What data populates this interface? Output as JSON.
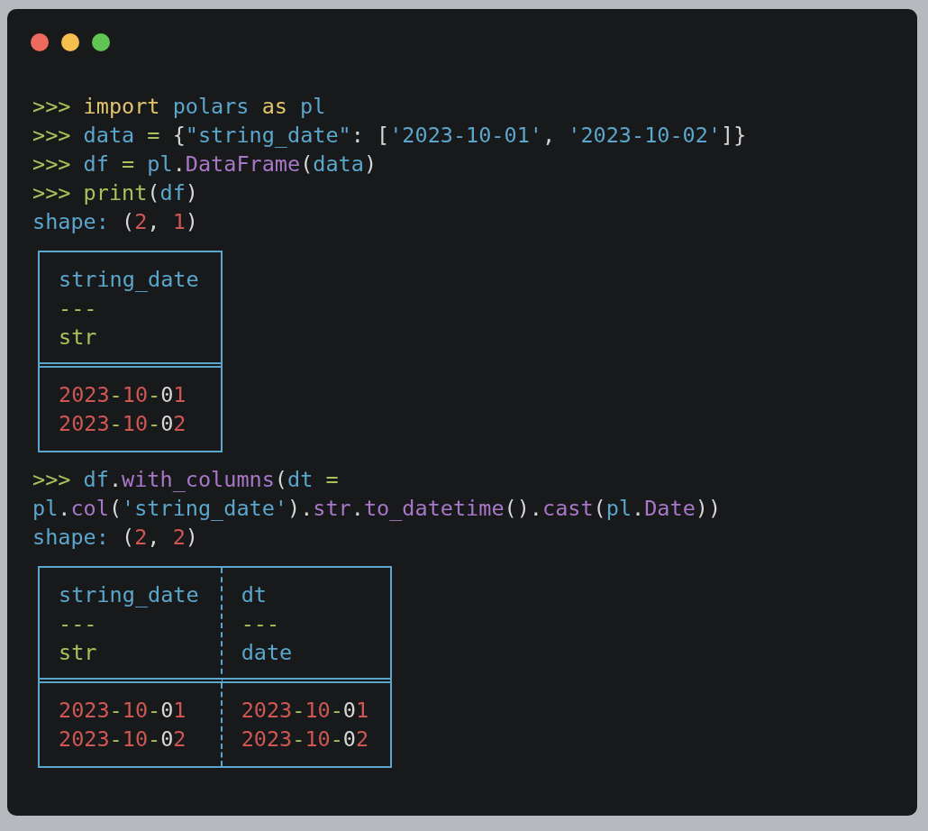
{
  "window_controls": [
    {
      "color": "#ec6a5e"
    },
    {
      "color": "#f4bf4f"
    },
    {
      "color": "#61c554"
    }
  ],
  "blocks": [
    {
      "kind": "line",
      "tokens": [
        {
          "text": ">>> ",
          "kind": "prompt"
        },
        {
          "text": "import",
          "kind": "keyword"
        },
        {
          "text": " polars ",
          "kind": "ident"
        },
        {
          "text": "as",
          "kind": "keyword"
        },
        {
          "text": " pl",
          "kind": "ident"
        }
      ]
    },
    {
      "kind": "line",
      "tokens": [
        {
          "text": ">>> ",
          "kind": "prompt"
        },
        {
          "text": "data ",
          "kind": "ident"
        },
        {
          "text": "=",
          "kind": "op"
        },
        {
          "text": " {",
          "kind": "punct"
        },
        {
          "text": "\"string_date\"",
          "kind": "ident"
        },
        {
          "text": ": [",
          "kind": "punct"
        },
        {
          "text": "'2023-10-01'",
          "kind": "ident"
        },
        {
          "text": ", ",
          "kind": "punct"
        },
        {
          "text": "'2023-10-02'",
          "kind": "ident"
        },
        {
          "text": "]}",
          "kind": "punct"
        }
      ]
    },
    {
      "kind": "line",
      "tokens": [
        {
          "text": ">>> ",
          "kind": "prompt"
        },
        {
          "text": "df ",
          "kind": "ident"
        },
        {
          "text": "=",
          "kind": "op"
        },
        {
          "text": " pl",
          "kind": "ident"
        },
        {
          "text": ".",
          "kind": "punct"
        },
        {
          "text": "DataFrame",
          "kind": "func"
        },
        {
          "text": "(",
          "kind": "punct"
        },
        {
          "text": "data",
          "kind": "ident"
        },
        {
          "text": ")",
          "kind": "punct"
        }
      ]
    },
    {
      "kind": "line",
      "tokens": [
        {
          "text": ">>> ",
          "kind": "prompt"
        },
        {
          "text": "print",
          "kind": "op"
        },
        {
          "text": "(",
          "kind": "punct"
        },
        {
          "text": "df",
          "kind": "ident"
        },
        {
          "text": ")",
          "kind": "punct"
        }
      ]
    },
    {
      "kind": "line",
      "tokens": [
        {
          "text": "shape: ",
          "kind": "ident"
        },
        {
          "text": "(",
          "kind": "punct"
        },
        {
          "text": "2",
          "kind": "number"
        },
        {
          "text": ", ",
          "kind": "punct"
        },
        {
          "text": "1",
          "kind": "number"
        },
        {
          "text": ")",
          "kind": "punct"
        }
      ]
    },
    {
      "kind": "table",
      "columns": [
        {
          "name": [
            {
              "text": "string_date",
              "kind": "ident"
            }
          ],
          "separator": [
            {
              "text": "---",
              "kind": "op"
            }
          ],
          "dtype": [
            {
              "text": "str",
              "kind": "op"
            }
          ]
        }
      ],
      "rows": [
        [
          [
            {
              "text": "2023",
              "kind": "number"
            },
            {
              "text": "-",
              "kind": "op"
            },
            {
              "text": "10",
              "kind": "number"
            },
            {
              "text": "-",
              "kind": "op"
            },
            {
              "text": "0",
              "kind": "punct"
            },
            {
              "text": "1",
              "kind": "number"
            }
          ]
        ],
        [
          [
            {
              "text": "2023",
              "kind": "number"
            },
            {
              "text": "-",
              "kind": "op"
            },
            {
              "text": "10",
              "kind": "number"
            },
            {
              "text": "-",
              "kind": "op"
            },
            {
              "text": "0",
              "kind": "punct"
            },
            {
              "text": "2",
              "kind": "number"
            }
          ]
        ]
      ]
    },
    {
      "kind": "line",
      "tokens": [
        {
          "text": ">>> ",
          "kind": "prompt"
        },
        {
          "text": "df",
          "kind": "ident"
        },
        {
          "text": ".",
          "kind": "punct"
        },
        {
          "text": "with_columns",
          "kind": "func"
        },
        {
          "text": "(",
          "kind": "punct"
        },
        {
          "text": "dt ",
          "kind": "ident"
        },
        {
          "text": "=",
          "kind": "op"
        }
      ]
    },
    {
      "kind": "line",
      "tokens": [
        {
          "text": "pl",
          "kind": "ident"
        },
        {
          "text": ".",
          "kind": "punct"
        },
        {
          "text": "col",
          "kind": "func"
        },
        {
          "text": "(",
          "kind": "punct"
        },
        {
          "text": "'string_date'",
          "kind": "ident"
        },
        {
          "text": ").",
          "kind": "punct"
        },
        {
          "text": "str",
          "kind": "func"
        },
        {
          "text": ".",
          "kind": "punct"
        },
        {
          "text": "to_datetime",
          "kind": "func"
        },
        {
          "text": "().",
          "kind": "punct"
        },
        {
          "text": "cast",
          "kind": "func"
        },
        {
          "text": "(",
          "kind": "punct"
        },
        {
          "text": "pl",
          "kind": "ident"
        },
        {
          "text": ".",
          "kind": "punct"
        },
        {
          "text": "Date",
          "kind": "func"
        },
        {
          "text": "))",
          "kind": "punct"
        }
      ]
    },
    {
      "kind": "line",
      "tokens": [
        {
          "text": "shape: ",
          "kind": "ident"
        },
        {
          "text": "(",
          "kind": "punct"
        },
        {
          "text": "2",
          "kind": "number"
        },
        {
          "text": ", ",
          "kind": "punct"
        },
        {
          "text": "2",
          "kind": "number"
        },
        {
          "text": ")",
          "kind": "punct"
        }
      ]
    },
    {
      "kind": "table",
      "columns": [
        {
          "name": [
            {
              "text": "string_date",
              "kind": "ident"
            }
          ],
          "separator": [
            {
              "text": "---",
              "kind": "op"
            }
          ],
          "dtype": [
            {
              "text": "str",
              "kind": "op"
            }
          ]
        },
        {
          "name": [
            {
              "text": "dt",
              "kind": "ident"
            }
          ],
          "separator": [
            {
              "text": "---",
              "kind": "op"
            }
          ],
          "dtype": [
            {
              "text": "date",
              "kind": "ident"
            }
          ]
        }
      ],
      "rows": [
        [
          [
            {
              "text": "2023",
              "kind": "number"
            },
            {
              "text": "-",
              "kind": "op"
            },
            {
              "text": "10",
              "kind": "number"
            },
            {
              "text": "-",
              "kind": "op"
            },
            {
              "text": "0",
              "kind": "punct"
            },
            {
              "text": "1",
              "kind": "number"
            }
          ],
          [
            {
              "text": "2023",
              "kind": "number"
            },
            {
              "text": "-",
              "kind": "op"
            },
            {
              "text": "10",
              "kind": "number"
            },
            {
              "text": "-",
              "kind": "op"
            },
            {
              "text": "0",
              "kind": "punct"
            },
            {
              "text": "1",
              "kind": "number"
            }
          ]
        ],
        [
          [
            {
              "text": "2023",
              "kind": "number"
            },
            {
              "text": "-",
              "kind": "op"
            },
            {
              "text": "10",
              "kind": "number"
            },
            {
              "text": "-",
              "kind": "op"
            },
            {
              "text": "0",
              "kind": "punct"
            },
            {
              "text": "2",
              "kind": "number"
            }
          ],
          [
            {
              "text": "2023",
              "kind": "number"
            },
            {
              "text": "-",
              "kind": "op"
            },
            {
              "text": "10",
              "kind": "number"
            },
            {
              "text": "-",
              "kind": "op"
            },
            {
              "text": "0",
              "kind": "punct"
            },
            {
              "text": "2",
              "kind": "number"
            }
          ]
        ]
      ]
    }
  ]
}
